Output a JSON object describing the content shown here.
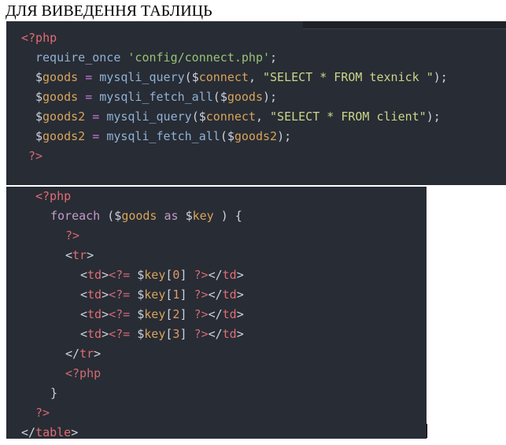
{
  "heading": "ДЛЯ ВИВЕДЕННЯ ТАБЛИЦЬ",
  "block1": {
    "open": "<?php",
    "l1": {
      "fn": "require_once",
      "str": "'config/connect.php'",
      "end": ";"
    },
    "l2": {
      "var": "goods",
      "fn": "mysqli_query",
      "arg": "connect",
      "str": "\"SELECT * FROM texnick \"",
      "end": ");"
    },
    "l3": {
      "var": "goods",
      "fn": "mysqli_fetch_all",
      "arg": "goods",
      "end": ");"
    },
    "l4": {
      "var": "goods2",
      "fn": "mysqli_query",
      "arg": "connect",
      "str": "\"SELECT * FROM client\"",
      "end": ");"
    },
    "l5": {
      "var": "goods2",
      "fn": "mysqli_fetch_all",
      "arg": "goods2",
      "end": ");"
    },
    "close": "?>"
  },
  "block2": {
    "open": "<?php",
    "foreach_kw": "foreach",
    "foreach_var": "goods",
    "as_kw": "as",
    "key_var": "key",
    "foreach_end": ") {",
    "close1": "?>",
    "tr_open": "<tr>",
    "td_rows": [
      {
        "idx": "0"
      },
      {
        "idx": "1"
      },
      {
        "idx": "2"
      },
      {
        "idx": "3"
      }
    ],
    "tr_close": "</tr>",
    "reopen": "<?php",
    "brace": "}",
    "close2": "?>",
    "table_close": "</table>"
  }
}
